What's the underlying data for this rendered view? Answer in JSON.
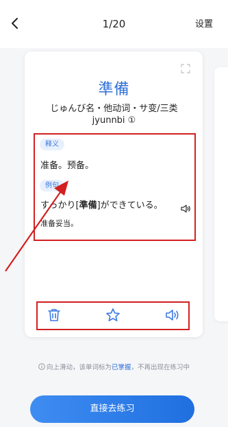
{
  "header": {
    "progress": "1/20",
    "settings_label": "设置"
  },
  "card": {
    "word": "準備",
    "reading": "じゅんび名・他动词・サ变/三类",
    "romaji": "jyunnbi ①",
    "meaning_tag": "释义",
    "meaning": "准备。预备。",
    "example_tag": "例句",
    "example_before": "すっかり[",
    "example_highlight": "準備",
    "example_after": "]ができている。",
    "example_translation": "准备妥当。"
  },
  "hint": {
    "before": "向上滑动，该单词标为",
    "emphasis": "已掌握",
    "after": "，不再出现在练习中"
  },
  "practice_button": "直接去练习",
  "colors": {
    "accent": "#2f6fd9",
    "annotation_red": "#d21f1f",
    "tag_bg": "#e8f0fd",
    "button_start": "#3f8df2",
    "button_end": "#1f6fe0"
  },
  "icons": {
    "back": "chevron-left-icon",
    "expand": "expand-icon",
    "sentence_audio": "speaker-icon",
    "delete": "trash-icon",
    "favorite": "star-icon",
    "word_audio": "speaker-icon",
    "info": "info-icon"
  }
}
